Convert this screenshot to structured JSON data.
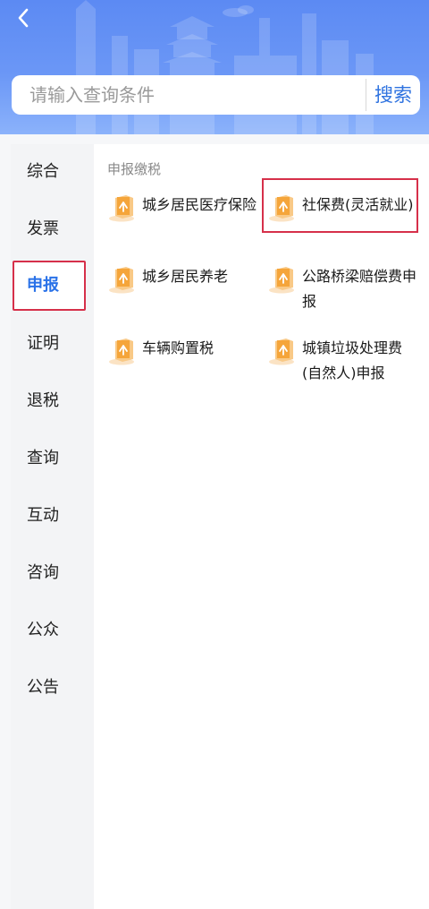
{
  "header": {
    "back_icon": "chevron-left-icon",
    "search": {
      "placeholder": "请输入查询条件",
      "button_label": "搜索"
    }
  },
  "sidebar": {
    "items": [
      {
        "label": "综合"
      },
      {
        "label": "发票"
      },
      {
        "label": "申报",
        "active": true
      },
      {
        "label": "证明"
      },
      {
        "label": "退税"
      },
      {
        "label": "查询"
      },
      {
        "label": "互动"
      },
      {
        "label": "咨询"
      },
      {
        "label": "公众"
      },
      {
        "label": "公告"
      }
    ]
  },
  "main": {
    "section_title": "申报缴税",
    "items": [
      {
        "label": "城乡居民医疗保险",
        "icon": "tax-form-icon"
      },
      {
        "label": "社保费(灵活就业)",
        "icon": "tax-form-icon",
        "highlighted": true
      },
      {
        "label": "城乡居民养老",
        "icon": "tax-form-icon"
      },
      {
        "label": "公路桥梁赔偿费申报",
        "icon": "tax-form-icon"
      },
      {
        "label": "车辆购置税",
        "icon": "tax-form-icon"
      },
      {
        "label": "城镇垃圾处理费(自然人)申报",
        "icon": "tax-form-icon"
      }
    ]
  },
  "colors": {
    "accent": "#2a72e8",
    "highlight_border": "#d6304a",
    "header_blue": "#5c8af3",
    "icon_orange": "#f5a53a"
  }
}
